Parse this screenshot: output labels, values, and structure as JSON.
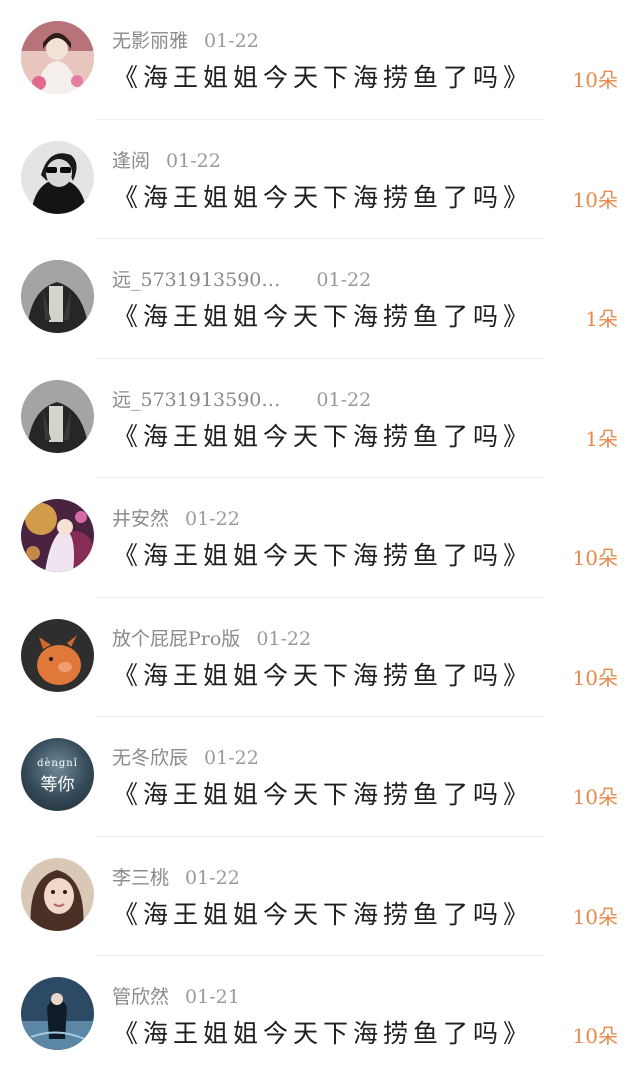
{
  "entries": [
    {
      "name": "无影丽雅",
      "date": "01-22",
      "message": "《海王姐姐今天下海捞鱼了吗》",
      "amount": "10朵",
      "avatar": {
        "icon": "avatar-girl-pink",
        "bg": "#d9a7a0",
        "accent": "#f2e6e0"
      }
    },
    {
      "name": "逢阅",
      "date": "01-22",
      "message": "《海王姐姐今天下海捞鱼了吗》",
      "amount": "10朵",
      "avatar": {
        "icon": "avatar-sunglasses-bw",
        "bg": "#cfcfcf",
        "accent": "#1c1c1c"
      }
    },
    {
      "name": "远_5731913590…",
      "date": "01-22",
      "message": "《海王姐姐今天下海捞鱼了吗》",
      "amount": "1朵",
      "avatar": {
        "icon": "avatar-jacket-man",
        "bg": "#6b6b6b",
        "accent": "#2a2a2a"
      }
    },
    {
      "name": "远_5731913590…",
      "date": "01-22",
      "message": "《海王姐姐今天下海捞鱼了吗》",
      "amount": "1朵",
      "avatar": {
        "icon": "avatar-jacket-man",
        "bg": "#6b6b6b",
        "accent": "#2a2a2a"
      }
    },
    {
      "name": "井安然",
      "date": "01-22",
      "message": "《海王姐姐今天下海捞鱼了吗》",
      "amount": "10朵",
      "avatar": {
        "icon": "avatar-anime-flowers",
        "bg": "#5a2d4a",
        "accent": "#e6b14a"
      }
    },
    {
      "name": "放个屁屁Pro版",
      "date": "01-22",
      "message": "《海王姐姐今天下海捞鱼了吗》",
      "amount": "10朵",
      "avatar": {
        "icon": "avatar-orange-pig",
        "bg": "#2a2a2a",
        "accent": "#e0783a"
      }
    },
    {
      "name": "无冬欣辰",
      "date": "01-22",
      "message": "《海王姐姐今天下海捞鱼了吗》",
      "amount": "10朵",
      "avatar": {
        "icon": "avatar-text-wait",
        "bg": "#344957",
        "accent": "#9bb1bf",
        "line1": "dèngnǐ",
        "line2": "等你"
      }
    },
    {
      "name": "李三桃",
      "date": "01-22",
      "message": "《海王姐姐今天下海捞鱼了吗》",
      "amount": "10朵",
      "avatar": {
        "icon": "avatar-girl-portrait",
        "bg": "#c9b6a3",
        "accent": "#3b2a22"
      }
    },
    {
      "name": "管欣然",
      "date": "01-21",
      "message": "《海王姐姐今天下海捞鱼了吗》",
      "amount": "10朵",
      "avatar": {
        "icon": "avatar-girl-blue-water",
        "bg": "#3c5d7a",
        "accent": "#0e1a24"
      }
    }
  ]
}
